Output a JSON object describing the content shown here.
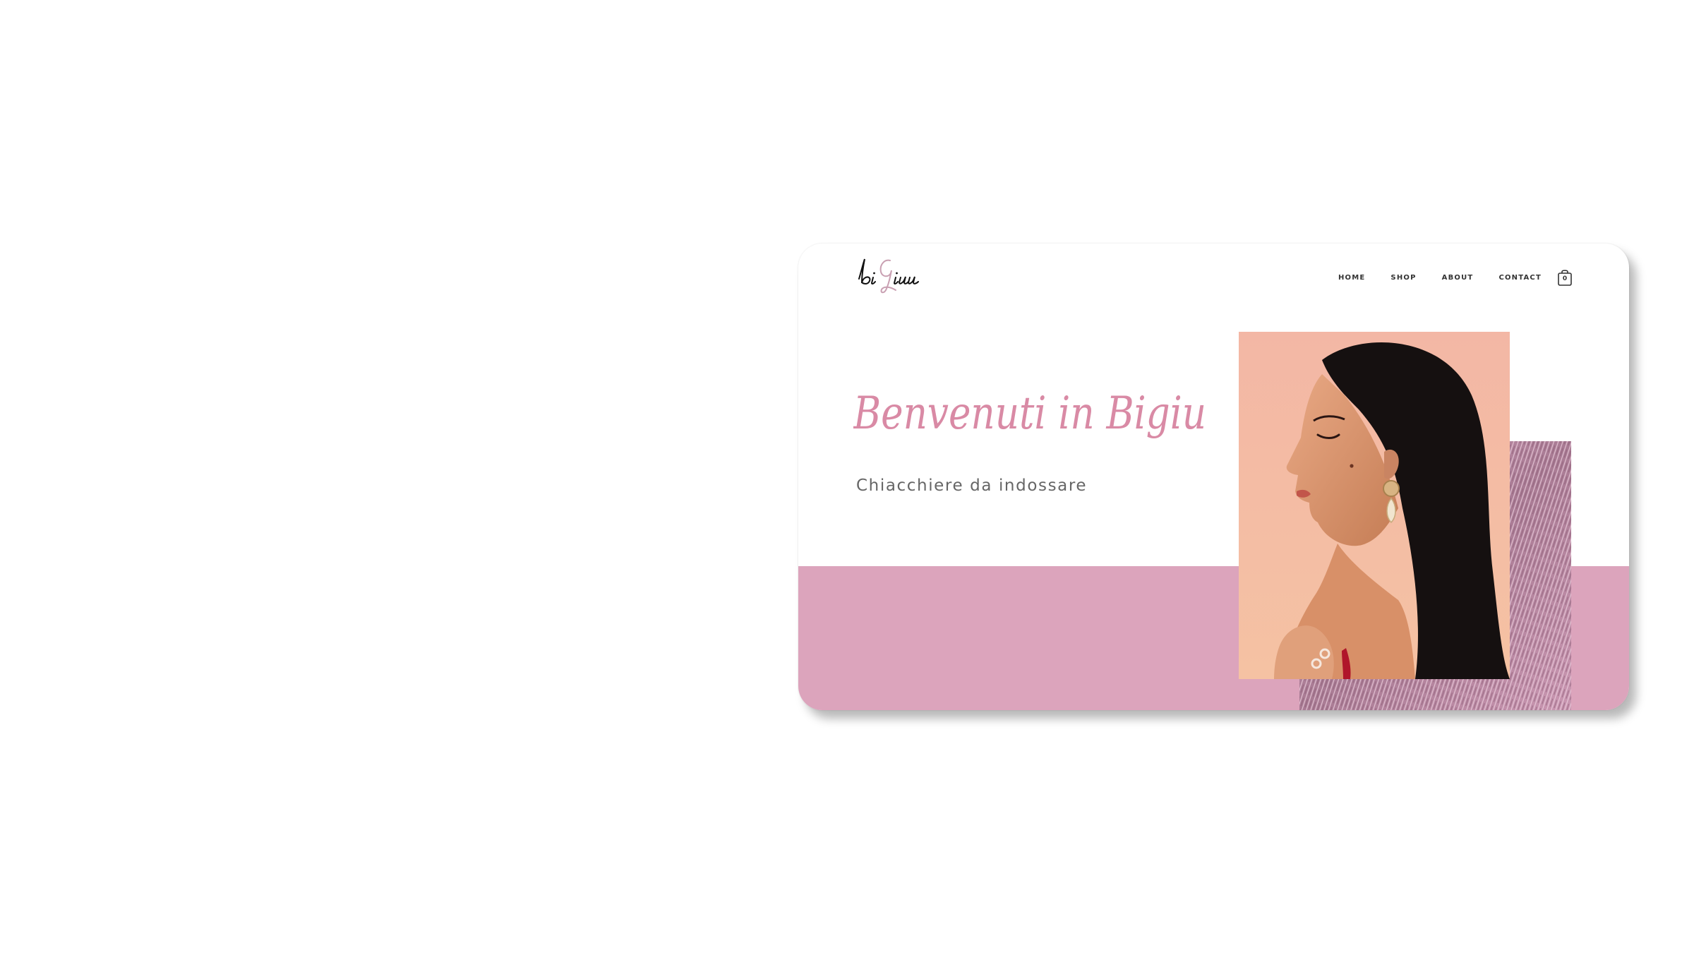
{
  "site": {
    "logo_text": "biGiu",
    "nav": {
      "items": [
        {
          "label": "HOME"
        },
        {
          "label": "SHOP"
        },
        {
          "label": "ABOUT"
        },
        {
          "label": "CONTACT"
        }
      ],
      "cart_count": "0"
    },
    "hero": {
      "title": "Benvenuti in Bigiu",
      "subtitle": "Chiacchiere da indossare"
    }
  },
  "colors": {
    "accent_pink": "#dca4bc",
    "script_pink": "#d98aa5",
    "nav_text": "#333333",
    "subtitle_text": "#666666",
    "portrait_background": "#f2b9a2"
  },
  "icons": {
    "cart": "shopping-bag-icon"
  }
}
